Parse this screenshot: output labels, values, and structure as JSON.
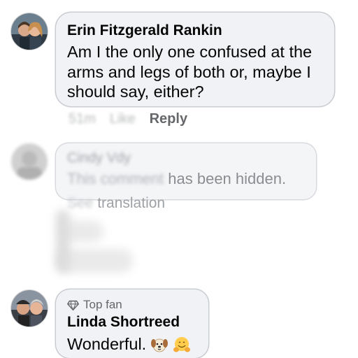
{
  "comments": [
    {
      "author": "Erin Fitzgerald Rankin",
      "text": "Am I the only one confused at the arms and legs of both or, maybe I should say, either?",
      "time": "51m",
      "like_label": "Like",
      "reply_label": "Reply"
    },
    {
      "author": "Cindy Vdy",
      "hidden_message": "This comment has been hidden.",
      "see_translation": "See translation"
    },
    {
      "badge": "Top fan",
      "badge_icon": "diamond-icon",
      "author": "Linda Shortreed",
      "text": "Wonderful.",
      "emojis": [
        "dog-face-emoji",
        "hugging-face-emoji"
      ]
    }
  ],
  "colors": {
    "bubble": "#f0f2f5",
    "bubble_border": "#c9ccd1",
    "secondary_text": "#65676b"
  }
}
